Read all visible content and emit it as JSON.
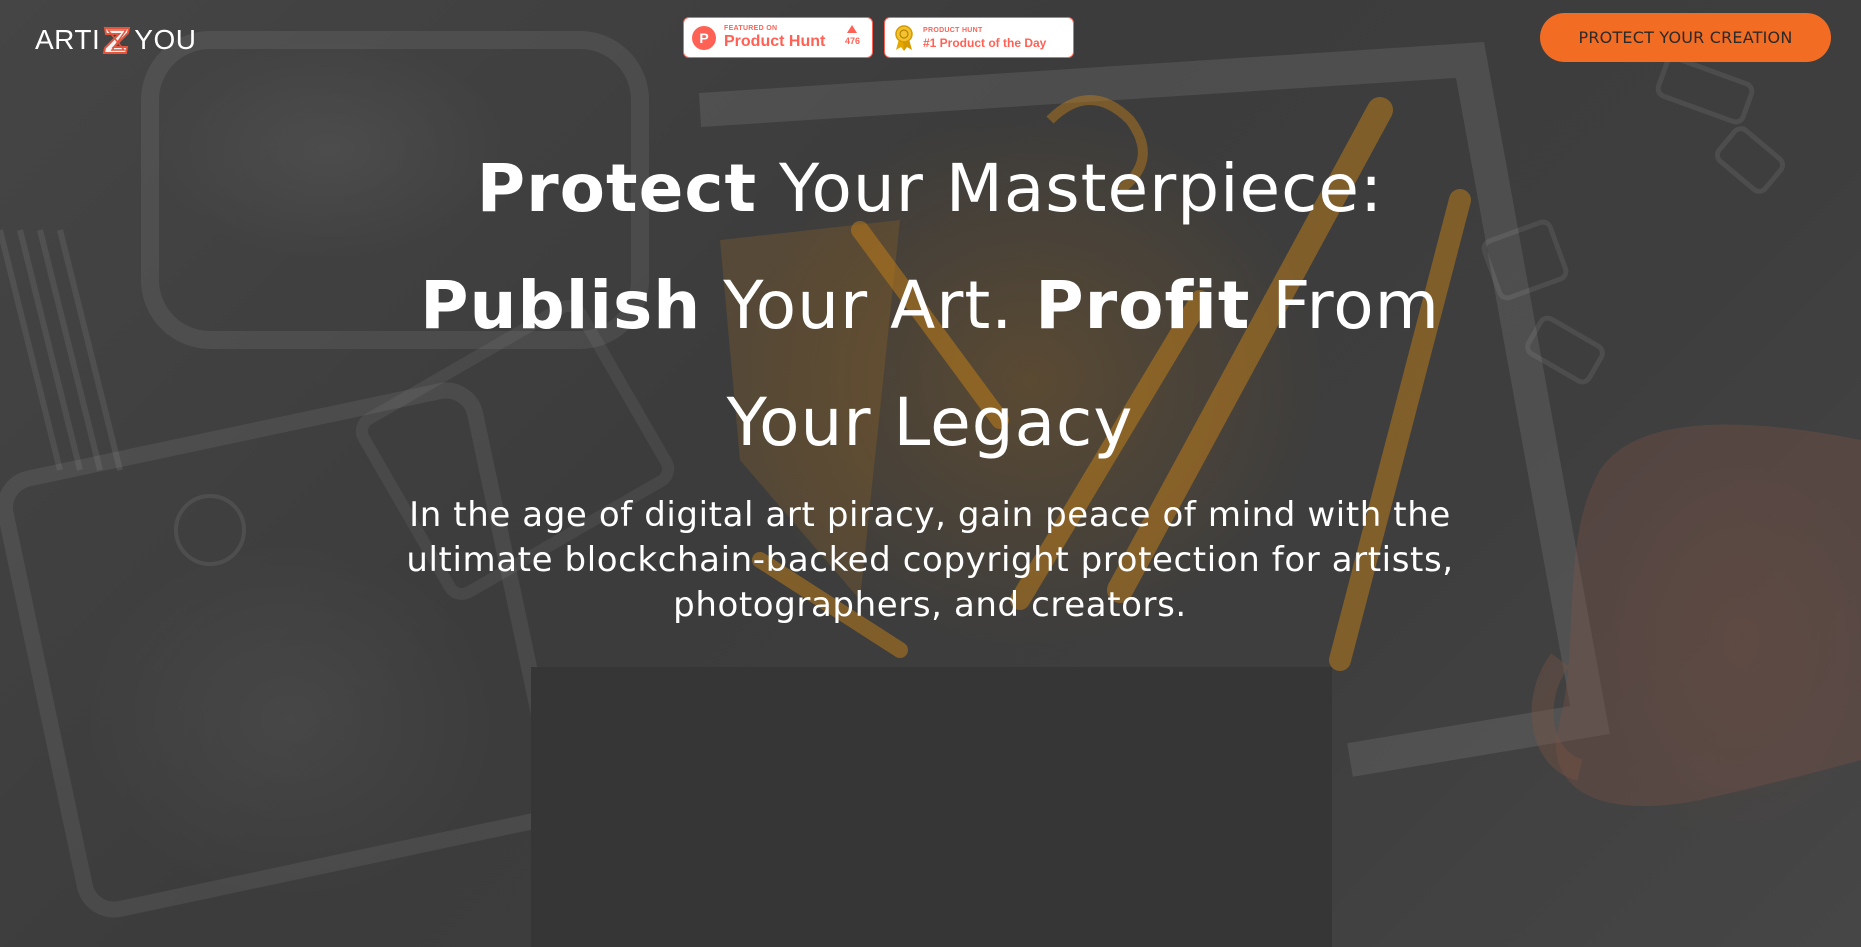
{
  "brand": {
    "logo_left": "ARTI",
    "logo_right": "YOU",
    "logo_icon": "z-logo-icon"
  },
  "badges": [
    {
      "small_label": "FEATURED ON",
      "big_label": "Product Hunt",
      "votes": "476",
      "icon": "product-hunt-icon"
    },
    {
      "small_label": "PRODUCT HUNT",
      "big_label": "#1 Product of the Day",
      "icon": "medal-icon"
    }
  ],
  "header": {
    "cta_label": "PROTECT YOUR CREATION"
  },
  "hero": {
    "line1_bold": "Protect",
    "line1_rest": " Your Masterpiece:",
    "line2_bold_a": "Publish",
    "line2_mid": " Your Art. ",
    "line2_bold_b": "Profit",
    "line2_rest": " From",
    "line3": "Your Legacy",
    "subtext": "In the age of digital art piracy, gain peace of mind with the ultimate blockchain-backed copyright protection for artists, photographers, and creators."
  },
  "colors": {
    "accent": "#f26c23",
    "product_hunt": "#ff6154",
    "background": "#3b3b3b",
    "text": "#ffffff"
  }
}
